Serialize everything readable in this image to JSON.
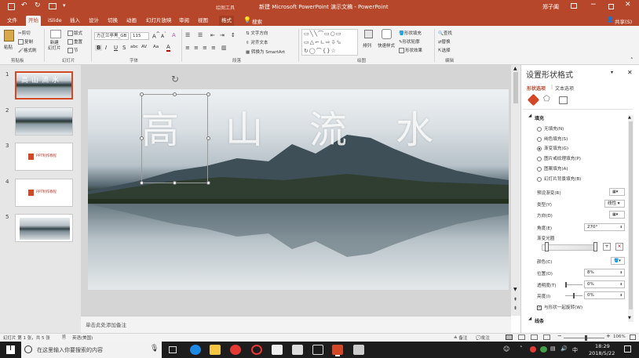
{
  "window": {
    "contextual_tab": "绘图工具",
    "title": "新建 Microsoft PowerPoint 演示文稿  -  PowerPoint",
    "user": "郑子阖",
    "share": "共享(S)"
  },
  "tabs": [
    "文件",
    "开始",
    "iSlide",
    "插入",
    "设计",
    "切换",
    "动画",
    "幻灯片放映",
    "审阅",
    "视图",
    "格式"
  ],
  "search": "搜索",
  "ribbon": {
    "clipboard": {
      "paste": "粘贴",
      "cut": "剪切",
      "copy": "复制",
      "format_painter": "格式刷",
      "label": "剪贴板"
    },
    "slides": {
      "new": "新建\n幻灯片",
      "layout": "版式",
      "reset": "重置",
      "section": "节",
      "label": "幻灯片"
    },
    "font": {
      "name": "方正兰亭黑_GB",
      "size": "115",
      "label": "字体",
      "bold": "B",
      "italic": "I",
      "underline": "U",
      "strike": "S",
      "shadow": "abc",
      "spacing": "AV",
      "case": "Aa",
      "color": "A"
    },
    "paragraph": {
      "text_direction": "文字方向",
      "align_text": "对齐文本",
      "smartart": "转换为 SmartArt",
      "label": "段落"
    },
    "drawing": {
      "arrange": "排列",
      "quick_styles": "快速样式",
      "fill": "形状填充",
      "outline": "形状轮廓",
      "effect": "形状效果",
      "label": "绘图"
    },
    "editing": {
      "find": "查找",
      "replace": "替换",
      "select": "选择",
      "label": "编辑"
    }
  },
  "thumbnails": [
    {
      "num": "1",
      "text": ""
    },
    {
      "num": "2",
      "text": ""
    },
    {
      "num": "3",
      "text": "PPT制作教程"
    },
    {
      "num": "4",
      "text": "PPT制作教程"
    },
    {
      "num": "5",
      "text": ""
    }
  ],
  "slide": {
    "chars": [
      "高",
      "山",
      "流",
      "水"
    ],
    "notes": "单击此处添加备注"
  },
  "pane": {
    "title": "设置形状格式",
    "tab1": "形状选项",
    "tab2": "文本选项",
    "fill_section": "填充",
    "fill_options": [
      "无填充(N)",
      "纯色填充(S)",
      "渐变填充(G)",
      "图片或纹理填充(P)",
      "图案填充(A)",
      "幻灯片背景填充(B)"
    ],
    "selected": "渐变填充(G)",
    "preset": "预设渐变(R)",
    "type_label": "类型(Y)",
    "type_value": "线性",
    "direction": "方向(D)",
    "angle_label": "角度(E)",
    "angle_value": "270°",
    "stops": "渐变光圈",
    "color": "颜色(C)",
    "position_label": "位置(O)",
    "position_value": "8%",
    "transparency_label": "透明度(T)",
    "transparency_value": "0%",
    "brightness_label": "亮度(I)",
    "brightness_value": "0%",
    "rotate": "与形状一起旋转(W)",
    "line_section": "线条"
  },
  "status": {
    "slide_info": "幻灯片 第 1 张，共 5 张",
    "language": "英语(美国)",
    "notes": "备注",
    "comments": "批注",
    "zoom": "106%"
  },
  "taskbar": {
    "search": "在这里输入你要搜索的内容",
    "time": "18:29",
    "date": "2018/5/22",
    "ime": "中"
  },
  "colors": {
    "accent": "#b7472a",
    "selection": "#d24726",
    "taskbar": "#1d1d1d"
  }
}
